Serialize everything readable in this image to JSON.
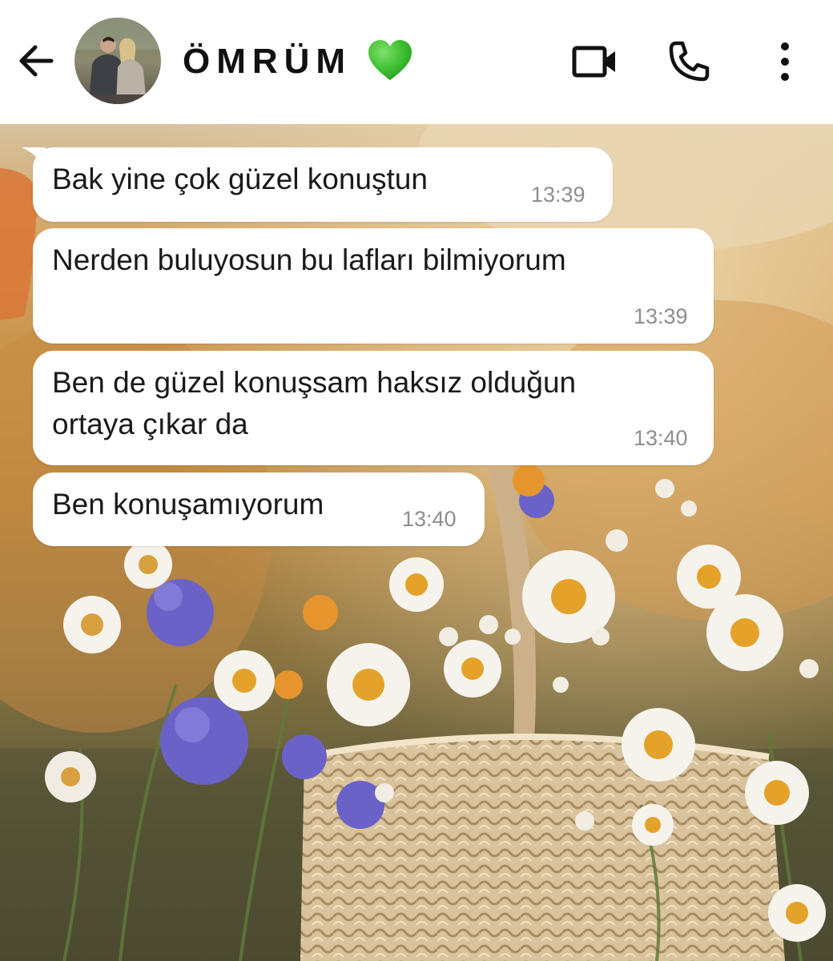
{
  "header": {
    "contact_name": "ÖMRÜM",
    "heart_emoji": "💚",
    "icons": {
      "back": "arrow-left-icon",
      "avatar": "contact-avatar",
      "video": "video-camera-icon",
      "call": "phone-icon",
      "more": "more-vertical-icon"
    }
  },
  "messages": [
    {
      "lines": [
        "Bak yine çok güzel konuştun"
      ],
      "time": "13:39"
    },
    {
      "lines": [
        "Nerden buluyosun bu lafları bilmiyorum"
      ],
      "time": "13:39"
    },
    {
      "lines": [
        "Ben de güzel konuşsam haksız olduğun",
        "ortaya çıkar da"
      ],
      "time": "13:40"
    },
    {
      "lines": [
        "Ben konuşamıyorum"
      ],
      "time": "13:40"
    }
  ],
  "colors": {
    "bubble": "#ffffff",
    "text": "#1a1a1a",
    "timestamp": "#8e8e8e",
    "header_bg": "#ffffff"
  }
}
